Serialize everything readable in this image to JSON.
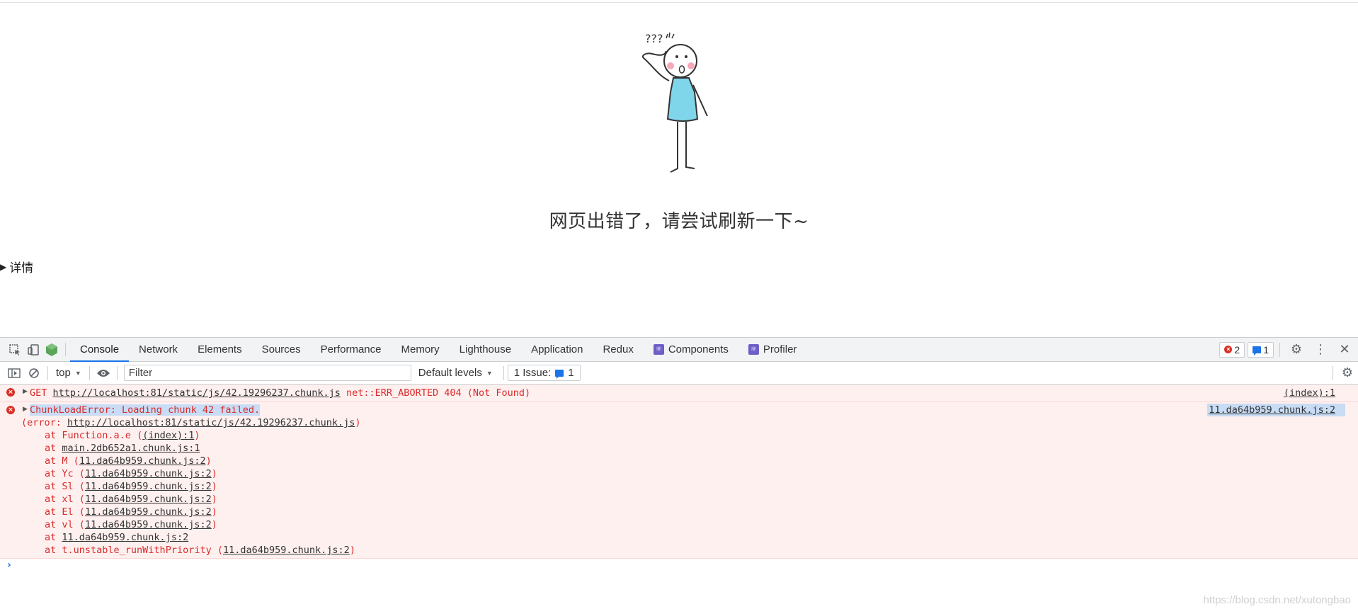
{
  "page": {
    "illustration_icon": "confused-stick-figure",
    "question_marks": "???",
    "error_title": "网页出错了，请尝试刷新一下~",
    "details_label": "详情"
  },
  "devtools": {
    "tabs": [
      {
        "label": "Console",
        "active": true
      },
      {
        "label": "Network"
      },
      {
        "label": "Elements"
      },
      {
        "label": "Sources"
      },
      {
        "label": "Performance"
      },
      {
        "label": "Memory"
      },
      {
        "label": "Lighthouse"
      },
      {
        "label": "Application"
      },
      {
        "label": "Redux"
      },
      {
        "label": "Components",
        "icon": "react-icon"
      },
      {
        "label": "Profiler",
        "icon": "react-icon"
      }
    ],
    "error_count": "2",
    "message_count": "1",
    "toolbar": {
      "context": "top",
      "filter_placeholder": "Filter",
      "levels": "Default levels",
      "issues_label": "1 Issue:",
      "issues_count": "1"
    },
    "messages": {
      "get_prefix": "GET ",
      "get_url": "http://localhost:81/static/js/42.19296237.chunk.js",
      "get_status": " net::ERR_ABORTED 404 (Not Found)",
      "get_source": "(index):1",
      "chunk_error": "ChunkLoadError: Loading chunk 42 failed.",
      "chunk_source": "11.da64b959.chunk.js:2",
      "error_prefix": "(error: ",
      "error_url": "http://localhost:81/static/js/42.19296237.chunk.js",
      "error_suffix": ")",
      "stack": [
        {
          "fn": "Function.a.e",
          "loc": "(index):1",
          "paren": true
        },
        {
          "fn": "",
          "loc": "main.2db652a1.chunk.js:1",
          "paren": false
        },
        {
          "fn": "M",
          "loc": "11.da64b959.chunk.js:2",
          "paren": true
        },
        {
          "fn": "Yc",
          "loc": "11.da64b959.chunk.js:2",
          "paren": true
        },
        {
          "fn": "Sl",
          "loc": "11.da64b959.chunk.js:2",
          "paren": true
        },
        {
          "fn": "xl",
          "loc": "11.da64b959.chunk.js:2",
          "paren": true
        },
        {
          "fn": "El",
          "loc": "11.da64b959.chunk.js:2",
          "paren": true
        },
        {
          "fn": "vl",
          "loc": "11.da64b959.chunk.js:2",
          "paren": true
        },
        {
          "fn": "",
          "loc": "11.da64b959.chunk.js:2",
          "paren": false
        },
        {
          "fn": "t.unstable_runWithPriority",
          "loc": "11.da64b959.chunk.js:2",
          "paren": true
        }
      ],
      "prompt": "›"
    }
  },
  "watermark": "https://blog.csdn.net/xutongbao",
  "colors": {
    "accent": "#1a73e8",
    "error_text": "#d92c2c",
    "error_bg": "#fef0ef",
    "figure_dress": "#7fd6ea"
  }
}
